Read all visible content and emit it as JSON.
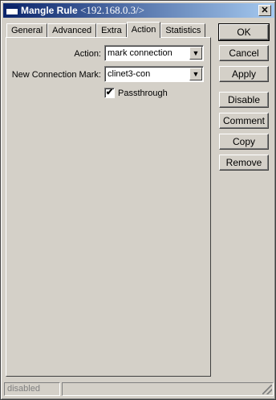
{
  "window": {
    "title_main": "Mangle Rule",
    "title_addr": "<192.168.0.3/>",
    "close_glyph": "✕"
  },
  "tabs": [
    {
      "label": "General"
    },
    {
      "label": "Advanced"
    },
    {
      "label": "Extra"
    },
    {
      "label": "Action",
      "active": true
    },
    {
      "label": "Statistics"
    }
  ],
  "form": {
    "action": {
      "label": "Action:",
      "value": "mark connection"
    },
    "new_connection_mark": {
      "label": "New Connection Mark:",
      "value": "clinet3-con"
    },
    "passthrough": {
      "label": "Passthrough",
      "checked": true
    }
  },
  "buttons": {
    "ok": "OK",
    "cancel": "Cancel",
    "apply": "Apply",
    "disable": "Disable",
    "comment": "Comment",
    "copy": "Copy",
    "remove": "Remove"
  },
  "status": {
    "text": "disabled"
  },
  "icons": {
    "dropdown": "▼",
    "check": "✔"
  }
}
